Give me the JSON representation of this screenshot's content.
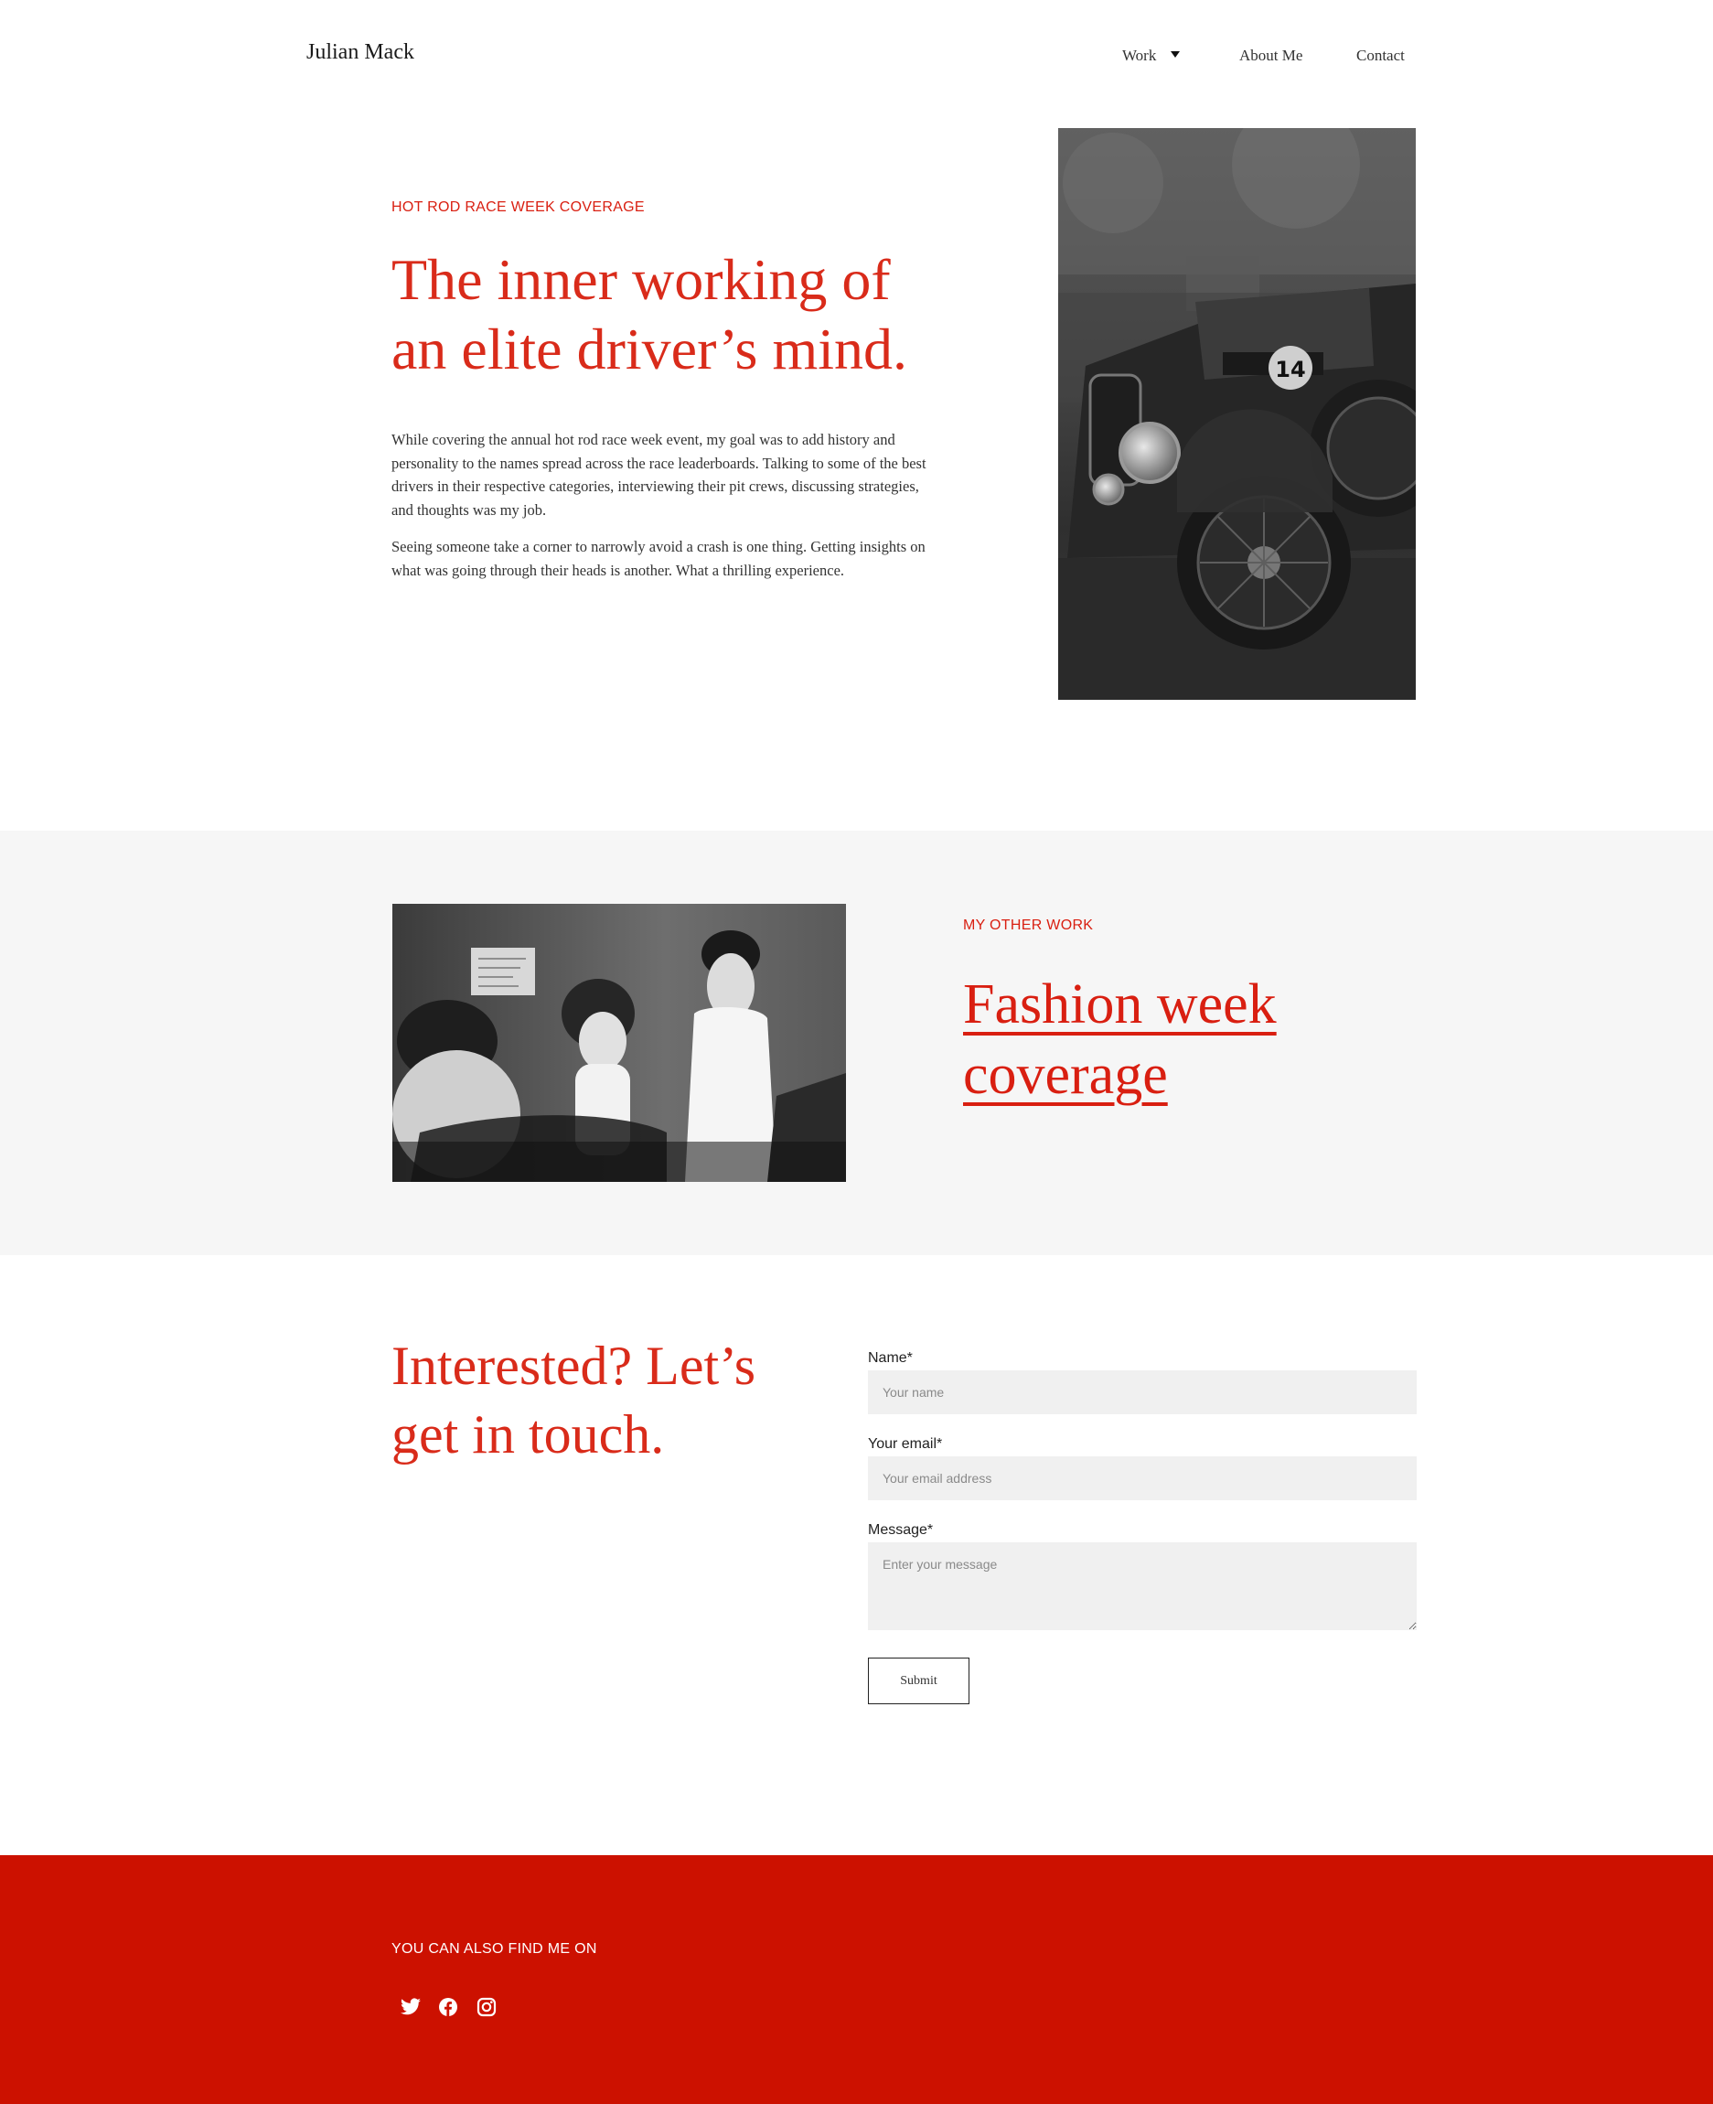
{
  "header": {
    "brand": "Julian Mack",
    "nav": [
      {
        "label": "Work",
        "has_dropdown": true
      },
      {
        "label": "About Me"
      },
      {
        "label": "Contact"
      }
    ]
  },
  "hero": {
    "eyebrow": "HOT ROD RACE WEEK COVERAGE",
    "title": "The inner working of an elite driver’s mind.",
    "paragraphs": [
      "While covering the annual hot rod race week event, my goal was to add history and personality to the names spread across the race leaderboards. Talking to some of the best drivers in their respective categories, interviewing their pit crews, discussing strategies, and thoughts was my job.",
      "Seeing someone take a corner to narrowly avoid a crash is one thing. Getting insights on what was going through their heads is another. What a thrilling experience."
    ],
    "car_number": "14"
  },
  "other_work": {
    "eyebrow": "MY OTHER WORK",
    "link_label": "Fashion week coverage"
  },
  "contact": {
    "title": "Interested? Let’s get in touch.",
    "name_label": "Name*",
    "name_placeholder": "Your name",
    "email_label": "Your email*",
    "email_placeholder": "Your email address",
    "message_label": "Message*",
    "message_placeholder": "Enter your message",
    "submit_label": "Submit"
  },
  "footer": {
    "heading": "YOU CAN ALSO FIND ME ON",
    "social": [
      "twitter-icon",
      "facebook-icon",
      "instagram-icon"
    ]
  },
  "colors": {
    "accent": "#d91f11",
    "footer_bg": "#cc1100",
    "band_bg": "#f6f6f6",
    "input_bg": "#f0f0f0"
  }
}
